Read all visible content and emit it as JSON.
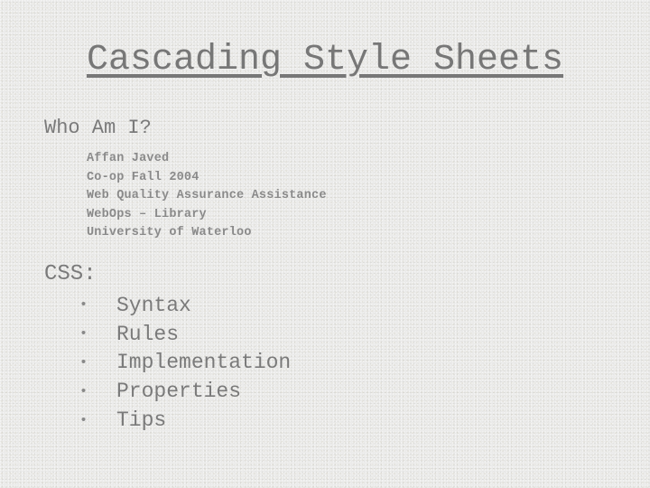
{
  "slide": {
    "title": "Cascading Style Sheets",
    "who": {
      "heading": "Who Am I?",
      "items": [
        "Affan Javed",
        "Co-op Fall 2004",
        "Web Quality Assurance Assistance",
        "WebOps – Library",
        "University of Waterloo"
      ]
    },
    "css": {
      "heading": "CSS:",
      "bullet_icon": "•",
      "items": [
        "Syntax",
        "Rules",
        "Implementation",
        "Properties",
        "Tips"
      ]
    }
  }
}
